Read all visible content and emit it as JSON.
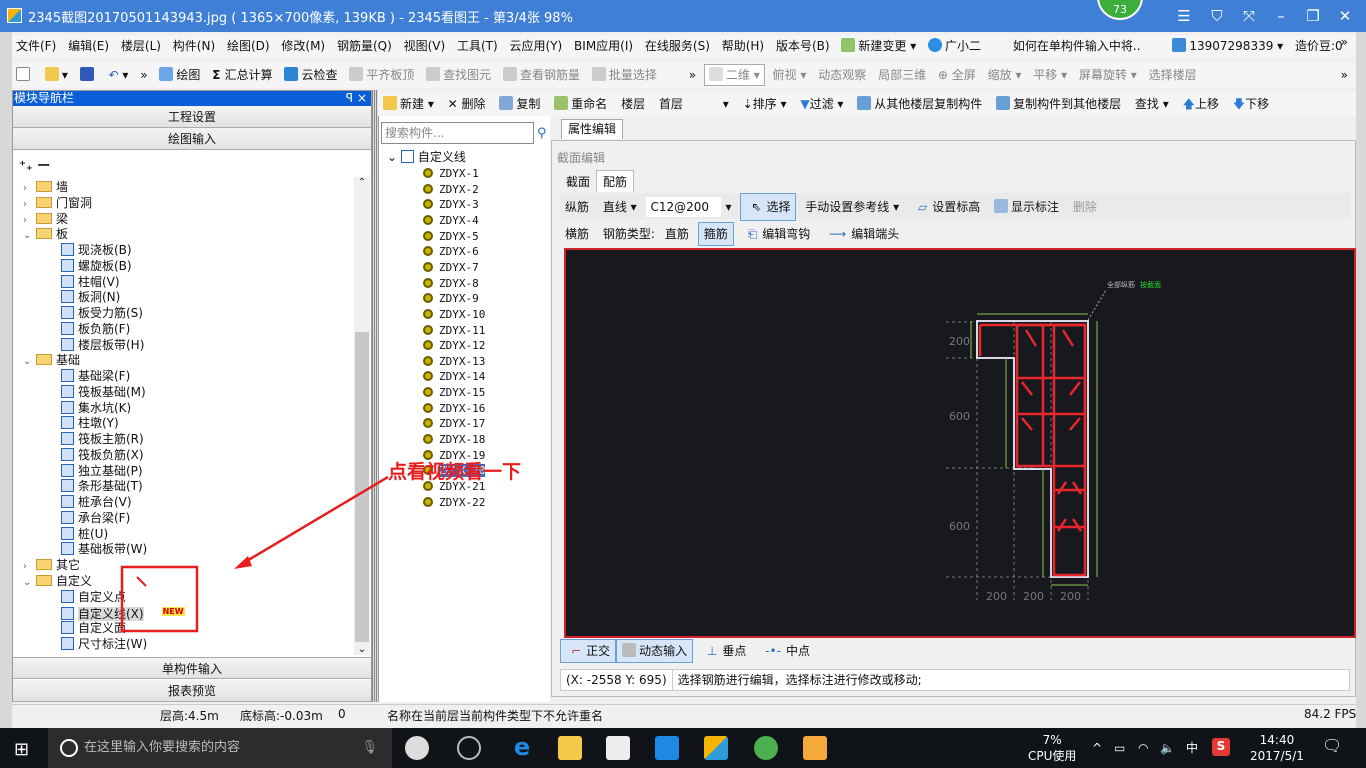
{
  "window": {
    "title": "2345截图20170501143943.jpg ( 1365×700像素, 139KB ) - 2345看图王 - 第3/4张 98%",
    "badge": "73",
    "controls": [
      "☰",
      "⛉",
      "⤧",
      "–",
      "❐",
      "✕"
    ]
  },
  "menubar": {
    "items": [
      "文件(F)",
      "编辑(E)",
      "楼层(L)",
      "构件(N)",
      "绘图(D)",
      "修改(M)",
      "钢筋量(Q)",
      "视图(V)",
      "工具(T)",
      "云应用(Y)",
      "BIM应用(I)",
      "在线服务(S)",
      "帮助(H)",
      "版本号(B)",
      "新建变更 ▾",
      "广小二",
      "如何在单构件输入中将..",
      "13907298339 ▾",
      "造价豆:0"
    ],
    "overflow": "»"
  },
  "toolbar": {
    "left": [
      "绘图",
      "汇总计算",
      "云检查",
      "平齐板顶",
      "查找图元",
      "查看钢筋量",
      "批量选择"
    ],
    "right": [
      "二维 ▾",
      "俯视 ▾",
      "动态观察",
      "局部三维",
      "全屏",
      "缩放 ▾",
      "平移 ▾",
      "屏幕旋转 ▾",
      "选择楼层"
    ],
    "overflow": "»"
  },
  "nav": {
    "title": "模块导航栏",
    "pin": "ꟼ",
    "close": "×",
    "sections": [
      "工程设置",
      "绘图输入",
      "单构件输入",
      "报表预览"
    ],
    "expand_collapse": "⁺₊ ⁻₋",
    "tree": [
      {
        "label": "墙",
        "type": "folder",
        "state": "collapsed"
      },
      {
        "label": "门窗洞",
        "type": "folder",
        "state": "collapsed"
      },
      {
        "label": "梁",
        "type": "folder",
        "state": "collapsed"
      },
      {
        "label": "板",
        "type": "folder",
        "state": "expanded"
      },
      {
        "label": "现浇板(B)",
        "type": "leaf"
      },
      {
        "label": "螺旋板(B)",
        "type": "leaf"
      },
      {
        "label": "柱帽(V)",
        "type": "leaf"
      },
      {
        "label": "板洞(N)",
        "type": "leaf"
      },
      {
        "label": "板受力筋(S)",
        "type": "leaf"
      },
      {
        "label": "板负筋(F)",
        "type": "leaf"
      },
      {
        "label": "楼层板带(H)",
        "type": "leaf"
      },
      {
        "label": "基础",
        "type": "folder",
        "state": "expanded"
      },
      {
        "label": "基础梁(F)",
        "type": "leaf"
      },
      {
        "label": "筏板基础(M)",
        "type": "leaf"
      },
      {
        "label": "集水坑(K)",
        "type": "leaf"
      },
      {
        "label": "柱墩(Y)",
        "type": "leaf"
      },
      {
        "label": "筏板主筋(R)",
        "type": "leaf"
      },
      {
        "label": "筏板负筋(X)",
        "type": "leaf"
      },
      {
        "label": "独立基础(P)",
        "type": "leaf"
      },
      {
        "label": "条形基础(T)",
        "type": "leaf"
      },
      {
        "label": "桩承台(V)",
        "type": "leaf"
      },
      {
        "label": "承台梁(F)",
        "type": "leaf"
      },
      {
        "label": "桩(U)",
        "type": "leaf"
      },
      {
        "label": "基础板带(W)",
        "type": "leaf"
      },
      {
        "label": "其它",
        "type": "folder",
        "state": "collapsed"
      },
      {
        "label": "自定义",
        "type": "folder",
        "state": "expanded"
      },
      {
        "label": "自定义点",
        "type": "leaf"
      },
      {
        "label": "自定义线(X)",
        "type": "leaf",
        "selected": true,
        "badge": "NEW"
      },
      {
        "label": "自定义面",
        "type": "leaf"
      },
      {
        "label": "尺寸标注(W)",
        "type": "leaf"
      }
    ]
  },
  "comptoolbar": {
    "items": [
      "新建 ▾",
      "✕ 删除",
      "复制",
      "重命名",
      "楼层",
      "首层",
      "▾",
      "排序 ▾",
      "过滤 ▾",
      "从其他楼层复制构件",
      "复制构件到其他楼层",
      "查找 ▾",
      "上移",
      "下移"
    ]
  },
  "complist": {
    "search_placeholder": "搜索构件...",
    "root": "自定义线",
    "items": [
      "ZDYX-1",
      "ZDYX-2",
      "ZDYX-3",
      "ZDYX-4",
      "ZDYX-5",
      "ZDYX-6",
      "ZDYX-7",
      "ZDYX-8",
      "ZDYX-9",
      "ZDYX-10",
      "ZDYX-11",
      "ZDYX-12",
      "ZDYX-13",
      "ZDYX-14",
      "ZDYX-15",
      "ZDYX-16",
      "ZDYX-17",
      "ZDYX-18",
      "ZDYX-19",
      "ZDYX-20",
      "ZDYX-21",
      "ZDYX-22"
    ],
    "selected": "ZDYX-20"
  },
  "propertyTab": "属性编辑",
  "editor": {
    "title": "截面编辑",
    "tabs": [
      "截面",
      "配筋"
    ],
    "active_tab": "配筋",
    "row1": {
      "label": "纵筋",
      "mode": "直线 ▾",
      "spec": "C12@200",
      "select": "选择",
      "refline": "手动设置参考线 ▾",
      "setElev": "设置标高",
      "showDim": "显示标注",
      "delete": "删除"
    },
    "row2": {
      "label": "横筋",
      "type_label": "钢筋类型:",
      "straight": "直筋",
      "stirrup": "箍筋",
      "editHook": "编辑弯钩",
      "editEnd": "编辑端头"
    },
    "canvas": {
      "dims_left": [
        "200",
        "600",
        "600"
      ],
      "dims_bottom": [
        "200",
        "200",
        "200"
      ],
      "annotation": "全部纵筋",
      "annotation_value": "按截面"
    },
    "bottom": {
      "ortho": "正交",
      "dynInput": "动态输入",
      "perp": "垂点",
      "mid": "中点"
    },
    "coords": "(X: -2558 Y: 695)",
    "hint": "选择钢筋进行编辑，选择标注进行修改或移动;"
  },
  "status": {
    "floorHeight": "层高:4.5m",
    "baseElev": "底标高:-0.03m",
    "zero": "0",
    "message": "名称在当前层当前构件类型下不允许重名",
    "fps": "84.2 FPS"
  },
  "annotation": {
    "text": "点看视频看一下",
    "color": "#e81e1e"
  },
  "taskbar": {
    "search_placeholder": "在这里输入你要搜索的内容",
    "cpu_pct": "7%",
    "cpu_label": "CPU使用",
    "ime": "中",
    "time": "14:40",
    "date": "2017/5/1"
  }
}
